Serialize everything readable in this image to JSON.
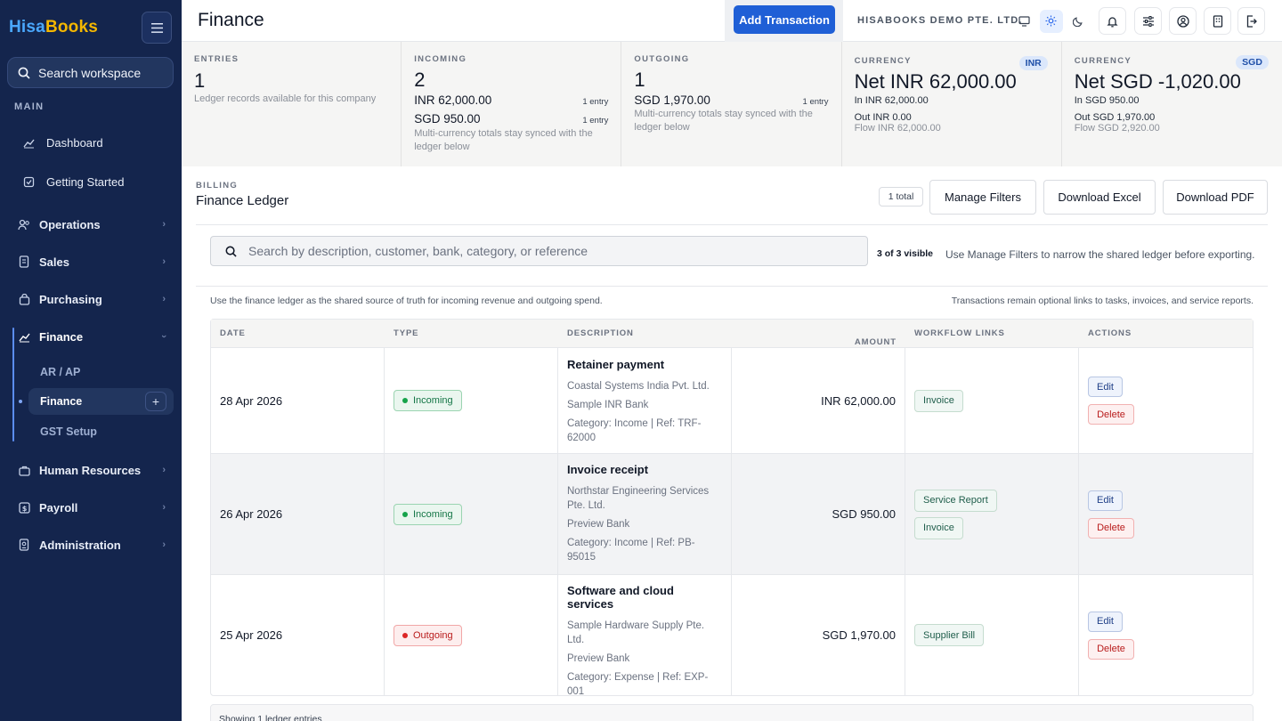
{
  "sidebar": {
    "logo_part1": "Hisa",
    "logo_part2": "Books",
    "search_label": "Search workspace",
    "section_main": "MAIN",
    "items": [
      {
        "label": "Dashboard"
      },
      {
        "label": "Getting Started"
      },
      {
        "label": "Operations"
      },
      {
        "label": "Sales"
      },
      {
        "label": "Purchasing"
      },
      {
        "label": "Finance"
      },
      {
        "label": "AR / AP"
      },
      {
        "label": "Finance"
      },
      {
        "label": "GST Setup"
      },
      {
        "label": "Human Resources"
      },
      {
        "label": "Payroll"
      },
      {
        "label": "Administration"
      }
    ]
  },
  "header": {
    "title": "Finance",
    "add_button": "Add Transaction",
    "company": "HISABOOKS DEMO PTE. LTD."
  },
  "cards": {
    "entries": {
      "label": "ENTRIES",
      "value": "1",
      "note": "Ledger records available for this company"
    },
    "incoming": {
      "label": "INCOMING",
      "value": "2",
      "rows": [
        {
          "amount": "INR 62,000.00",
          "count": "1 entry"
        },
        {
          "amount": "SGD 950.00",
          "count": "1 entry"
        }
      ],
      "note": "Multi-currency totals stay synced with the ledger below"
    },
    "outgoing": {
      "label": "OUTGOING",
      "value": "1",
      "rows": [
        {
          "amount": "SGD 1,970.00",
          "count": "1 entry"
        }
      ],
      "note": "Multi-currency totals stay synced with the ledger below"
    },
    "currency_inr": {
      "label": "CURRENCY",
      "pill": "INR",
      "net": "Net INR 62,000.00",
      "in": "In INR 62,000.00",
      "out": "Out INR 0.00",
      "flow": "Flow INR 62,000.00"
    },
    "currency_sgd": {
      "label": "CURRENCY",
      "pill": "SGD",
      "net": "Net SGD -1,020.00",
      "in": "In SGD 950.00",
      "out": "Out SGD 1,970.00",
      "flow": "Flow SGD 2,920.00"
    }
  },
  "ledger": {
    "section": "BILLING",
    "title": "Finance Ledger",
    "total_badge": "1 total",
    "manage_filters": "Manage Filters",
    "download_excel": "Download Excel",
    "download_pdf": "Download PDF",
    "search_placeholder": "Search by description, customer, bank, category, or reference",
    "visible_count": "3 of 3 visible",
    "visible_hint": "Use Manage Filters to narrow the shared ledger before exporting.",
    "info_left": "Use the finance ledger as the shared source of truth for incoming revenue and outgoing spend.",
    "info_right": "Transactions remain optional links to tasks, invoices, and service reports.",
    "columns": [
      "DATE",
      "TYPE",
      "DESCRIPTION",
      "AMOUNT",
      "WORKFLOW LINKS",
      "ACTIONS"
    ],
    "edit_label": "Edit",
    "delete_label": "Delete",
    "rows": [
      {
        "date": "28 Apr 2026",
        "type": "Incoming",
        "title": "Retainer payment",
        "lines": [
          "Coastal Systems India Pvt. Ltd.",
          "Sample INR Bank",
          "Category: Income | Ref: TRF-62000"
        ],
        "amount": "INR 62,000.00",
        "links": [
          "Invoice"
        ]
      },
      {
        "date": "26 Apr 2026",
        "type": "Incoming",
        "title": "Invoice receipt",
        "lines": [
          "Northstar Engineering Services Pte. Ltd.",
          "Preview Bank",
          "Category: Income | Ref: PB-95015"
        ],
        "amount": "SGD 950.00",
        "links": [
          "Service Report",
          "Invoice"
        ]
      },
      {
        "date": "25 Apr 2026",
        "type": "Outgoing",
        "title": "Software and cloud services",
        "lines": [
          "Sample Hardware Supply Pte. Ltd.",
          "Preview Bank",
          "Category: Expense | Ref: EXP-001"
        ],
        "amount": "SGD 1,970.00",
        "links": [
          "Supplier Bill"
        ]
      }
    ],
    "footer": "Showing 1 ledger entries"
  }
}
